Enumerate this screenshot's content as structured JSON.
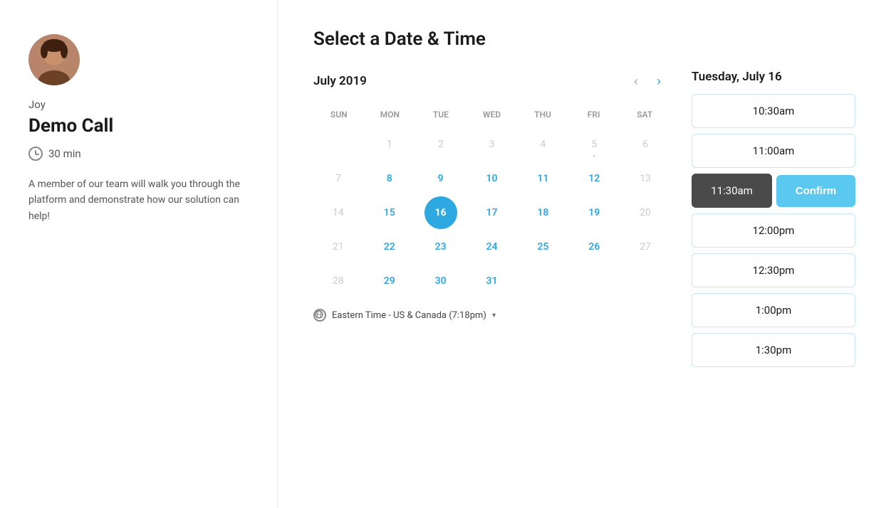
{
  "leftPanel": {
    "hostName": "Joy",
    "eventTitle": "Demo Call",
    "duration": "30 min",
    "description": "A member of our team will walk you through the platform and demonstrate how our solution can help!"
  },
  "header": {
    "title": "Select a Date & Time"
  },
  "calendar": {
    "monthLabel": "July 2019",
    "dayHeaders": [
      "SUN",
      "MON",
      "TUE",
      "WED",
      "THU",
      "FRI",
      "SAT"
    ],
    "selectedDate": "Tuesday, July 16",
    "days": [
      {
        "num": "",
        "state": "empty"
      },
      {
        "num": "1",
        "state": "disabled"
      },
      {
        "num": "2",
        "state": "disabled"
      },
      {
        "num": "3",
        "state": "disabled"
      },
      {
        "num": "4",
        "state": "disabled"
      },
      {
        "num": "5",
        "state": "disabled",
        "dot": true
      },
      {
        "num": "6",
        "state": "disabled"
      },
      {
        "num": "7",
        "state": "disabled"
      },
      {
        "num": "8",
        "state": "available"
      },
      {
        "num": "9",
        "state": "available"
      },
      {
        "num": "10",
        "state": "available"
      },
      {
        "num": "11",
        "state": "available"
      },
      {
        "num": "12",
        "state": "available"
      },
      {
        "num": "13",
        "state": "disabled"
      },
      {
        "num": "14",
        "state": "disabled"
      },
      {
        "num": "15",
        "state": "available"
      },
      {
        "num": "16",
        "state": "selected"
      },
      {
        "num": "17",
        "state": "available"
      },
      {
        "num": "18",
        "state": "available"
      },
      {
        "num": "19",
        "state": "available"
      },
      {
        "num": "20",
        "state": "disabled"
      },
      {
        "num": "21",
        "state": "disabled"
      },
      {
        "num": "22",
        "state": "available"
      },
      {
        "num": "23",
        "state": "available"
      },
      {
        "num": "24",
        "state": "available"
      },
      {
        "num": "25",
        "state": "available"
      },
      {
        "num": "26",
        "state": "available"
      },
      {
        "num": "27",
        "state": "disabled"
      },
      {
        "num": "28",
        "state": "disabled"
      },
      {
        "num": "29",
        "state": "available"
      },
      {
        "num": "30",
        "state": "available"
      },
      {
        "num": "31",
        "state": "available"
      },
      {
        "num": "",
        "state": "empty"
      },
      {
        "num": "",
        "state": "empty"
      },
      {
        "num": "",
        "state": "empty"
      }
    ]
  },
  "timezone": {
    "label": "Eastern Time - US & Canada (7:18pm)"
  },
  "timeSlots": {
    "slots": [
      {
        "time": "10:30am",
        "state": "normal"
      },
      {
        "time": "11:00am",
        "state": "normal"
      },
      {
        "time": "11:30am",
        "state": "selected"
      },
      {
        "time": "12:00pm",
        "state": "normal"
      },
      {
        "time": "12:30pm",
        "state": "normal"
      },
      {
        "time": "1:00pm",
        "state": "normal"
      },
      {
        "time": "1:30pm",
        "state": "partial"
      }
    ],
    "confirmLabel": "Confirm"
  },
  "nav": {
    "prevLabel": "‹",
    "nextLabel": "›"
  }
}
